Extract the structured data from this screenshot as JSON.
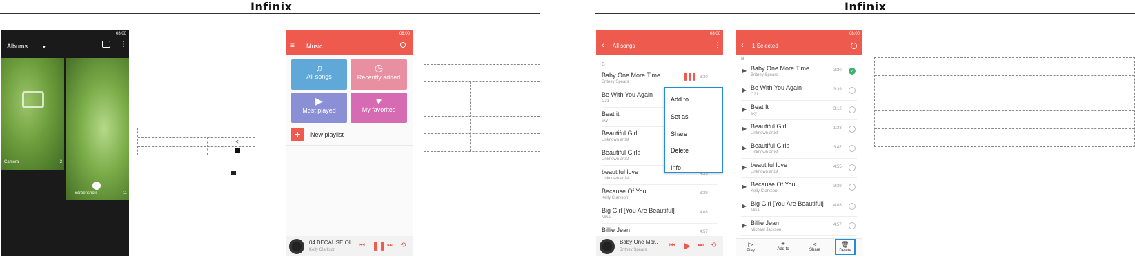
{
  "brand": "Infinix",
  "status_time": "08:00",
  "gallery": {
    "title": "Albums",
    "albums": [
      {
        "name": "Camera",
        "count": "3"
      },
      {
        "name": "Screenshots",
        "count": "11"
      }
    ]
  },
  "music": {
    "title": "Music",
    "tiles": [
      {
        "label": "All songs",
        "icon": "music-note-icon",
        "color": "#5fa8d8"
      },
      {
        "label": "Recently added",
        "icon": "clock-icon",
        "color": "#e98fa2"
      },
      {
        "label": "Most played",
        "icon": "play-circle-icon",
        "color": "#8a8fd6"
      },
      {
        "label": "My favorites",
        "icon": "heart-icon",
        "color": "#d66ab3"
      }
    ],
    "new_playlist": "New playlist",
    "now_playing": {
      "title": "04.BECAUSE OI",
      "artist": "Kelly Clarkson"
    }
  },
  "all_songs": {
    "title": "All songs",
    "section": "B",
    "songs": [
      {
        "title": "Baby One More Time",
        "artist": "Britney Spears",
        "duration": "3:30"
      },
      {
        "title": "Be With You Again",
        "artist": "C21",
        "duration": ""
      },
      {
        "title": "Beat   it",
        "artist": "sky",
        "duration": ""
      },
      {
        "title": "Beautiful Girl",
        "artist": "Unknown artist",
        "duration": ""
      },
      {
        "title": "Beautiful Girls",
        "artist": "Unknown artist",
        "duration": ""
      },
      {
        "title": "beautiful love",
        "artist": "Unknown artist",
        "duration": "4:55"
      },
      {
        "title": "Because Of You",
        "artist": "Kelly Clarkson",
        "duration": "3:39"
      },
      {
        "title": "Big Girl [You Are Beautiful]",
        "artist": "Mika",
        "duration": "4:08"
      },
      {
        "title": "Billie Jean",
        "artist": "",
        "duration": "4:57"
      }
    ],
    "menu": [
      "Add to",
      "Set as",
      "Share",
      "Delete",
      "Info"
    ],
    "now_playing": {
      "title": "Baby One Mor..",
      "artist": "Britney Spears"
    }
  },
  "selected": {
    "title": "1 Selected",
    "section": "B",
    "songs": [
      {
        "title": "Baby One More Time",
        "artist": "Britney Spears",
        "duration": "3:30",
        "checked": true
      },
      {
        "title": "Be With You Again",
        "artist": "C21",
        "duration": "3:39",
        "checked": false
      },
      {
        "title": "Beat   It",
        "artist": "sky",
        "duration": "3:12",
        "checked": false
      },
      {
        "title": "Beautiful Girl",
        "artist": "Unknown artist",
        "duration": "1:33",
        "checked": false
      },
      {
        "title": "Beautiful Girls",
        "artist": "Unknown artist",
        "duration": "3:47",
        "checked": false
      },
      {
        "title": "beautiful love",
        "artist": "Unknown artist",
        "duration": "4:55",
        "checked": false
      },
      {
        "title": "Because Of You",
        "artist": "Kelly Clarkson",
        "duration": "3:39",
        "checked": false
      },
      {
        "title": "Big Girl [You Are Beautiful]",
        "artist": "Mika",
        "duration": "4:08",
        "checked": false
      },
      {
        "title": "Billie Jean",
        "artist": "Michael Jackson",
        "duration": "4:57",
        "checked": false
      }
    ],
    "toolbar": [
      "Play",
      "Add to",
      "Share",
      "Delete"
    ]
  },
  "colors": {
    "accent": "#ef5a4f",
    "highlight": "#1e8fd6"
  }
}
